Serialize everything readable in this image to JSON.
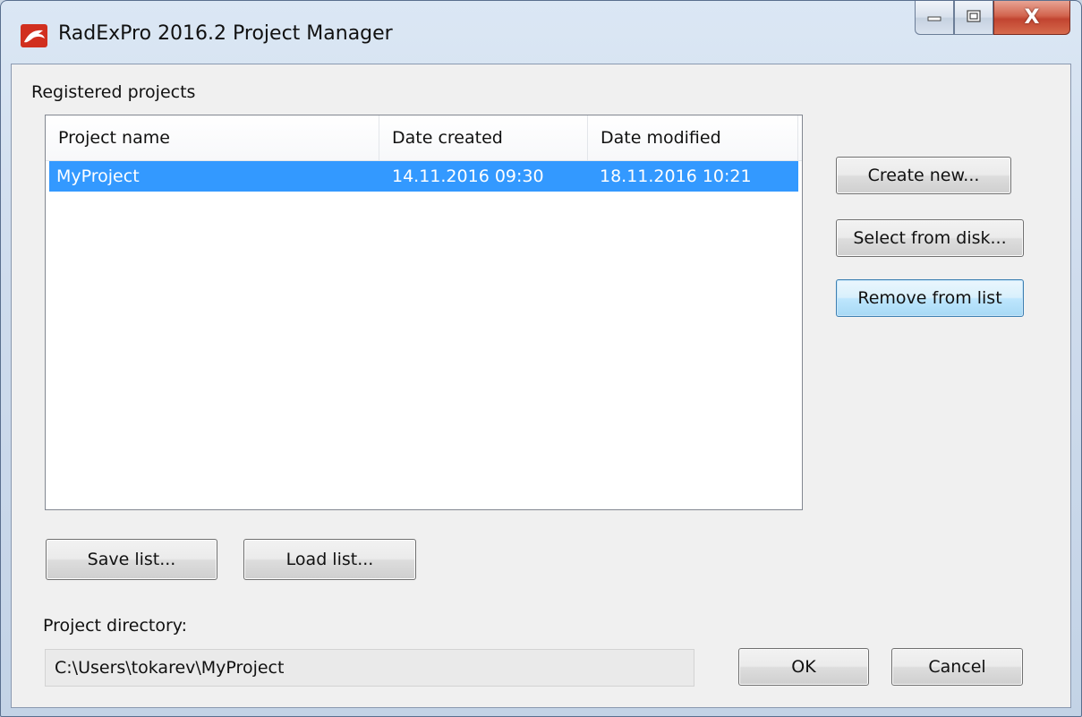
{
  "window": {
    "title": "RadExPro 2016.2  Project Manager",
    "icon": "radexpro-app-icon",
    "caption_buttons": [
      "minimize-icon",
      "maximize-icon",
      "close-icon"
    ],
    "close_label": "X"
  },
  "registered": {
    "label": "Registered projects",
    "columns": [
      "Project name",
      "Date created",
      "Date modified"
    ],
    "rows": [
      {
        "name": "MyProject",
        "created": "14.11.2016  09:30",
        "modified": "18.11.2016  10:21",
        "selected": true
      }
    ]
  },
  "actions": {
    "create_new": "Create new...",
    "select_from_disk": "Select from disk...",
    "remove_from_list": "Remove from list"
  },
  "list_buttons": {
    "save": "Save list...",
    "load": "Load list..."
  },
  "directory": {
    "label": "Project directory:",
    "value": "C:\\Users\\tokarev\\MyProject"
  },
  "dialog_buttons": {
    "ok": "OK",
    "cancel": "Cancel"
  },
  "colors": {
    "selection": "#3399ff",
    "close_button": "#c14430",
    "app_icon": "#d12f1f"
  }
}
